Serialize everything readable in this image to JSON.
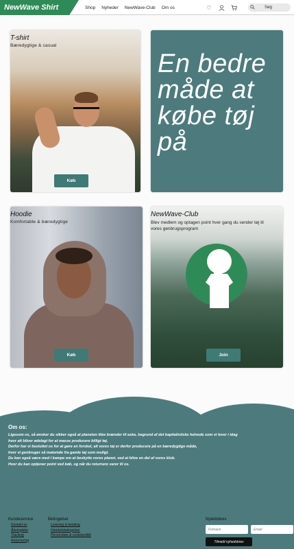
{
  "header": {
    "logo": "NewWave Shirt",
    "nav": [
      "Shop",
      "Nyheder",
      "NewWave-Club",
      "Om os"
    ],
    "search_label": "Søg"
  },
  "cards": {
    "tshirt": {
      "title": "T-shirt",
      "subtitle": "Bæredygtige & casual",
      "button": "Køb"
    },
    "slogan": {
      "text": "En bedre måde at købe tøj på"
    },
    "hoodie": {
      "title": "Hoodie",
      "subtitle": "Komfortable & bæredygtige",
      "button": "Køb"
    },
    "club": {
      "title": "NewWave-Club",
      "description": "Blev medlem og optagen point hver gang du sender tøj til vores genbrugsprogram",
      "button": "Join"
    }
  },
  "about": {
    "title": "Om os:",
    "lines": [
      "Ligesom os, så ønsker du sikker også at planeten ikke brænder til aske, begrund af det kapitalistiske helvede som vi lever i idag",
      "hvor alt bliver ødelagt for at masse producere billigt tøj.",
      "Derfor har vi besluttet os for at gøre en forskel, alt vores tøj er derfor producere på en bæredygtige måde,",
      "hvor vi genbruger så materiale fra gamle tøj som muligt.",
      "Du kan også være med i kampe om at beskytte vores planet, ved at blive en del af vores klub.",
      "Hvor du kan optjener point ved køb, og når du returnere varer til os."
    ]
  },
  "footer": {
    "kundeservice": {
      "title": "Kundeservice",
      "links": [
        "Kontakt os",
        "Åbningtider",
        "Tracking",
        "Returnering"
      ]
    },
    "betingelser": {
      "title": "Betingelser",
      "links": [
        "Levering & betaling",
        "Handelsbetingelser",
        "Persondata & cookiepolitik"
      ]
    },
    "newsletter": {
      "title": "Nytedsbrev",
      "name_placeholder": "Fornavn",
      "email_placeholder": "Email",
      "button": "Tilmeld nyhedsbrev"
    }
  },
  "colors": {
    "logo_green": "#2e8b57",
    "teal": "#4d7b7d",
    "button_teal": "#3f7a76"
  }
}
